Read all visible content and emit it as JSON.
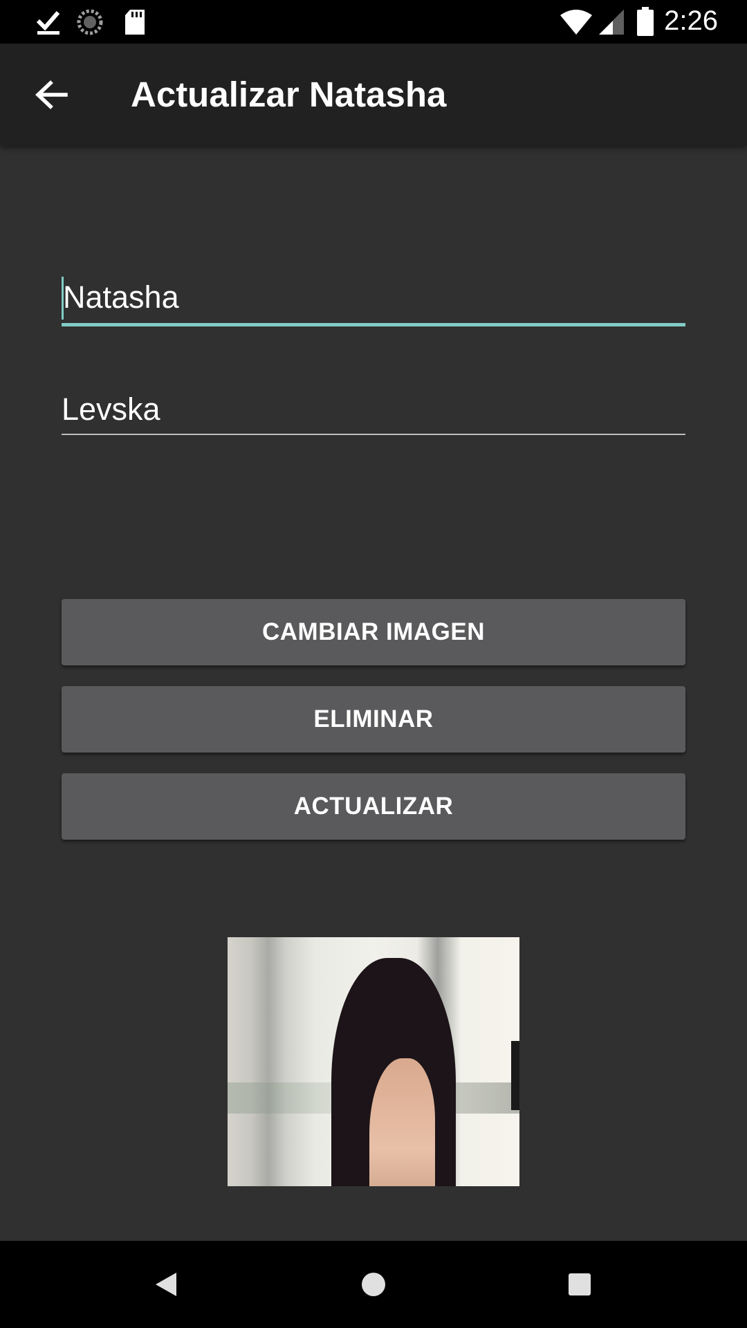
{
  "status_bar": {
    "time": "2:26",
    "icons": [
      "download-done-icon",
      "sync-icon",
      "sd-card-icon",
      "wifi-icon",
      "signal-icon",
      "battery-icon"
    ]
  },
  "app_bar": {
    "back_icon": "arrow-back-icon",
    "title": "Actualizar Natasha"
  },
  "form": {
    "first_name": {
      "value": "Natasha",
      "focused": true
    },
    "last_name": {
      "value": "Levska",
      "focused": false
    }
  },
  "buttons": {
    "change_image": "CAMBIAR IMAGEN",
    "delete": "ELIMINAR",
    "update": "ACTUALIZAR"
  },
  "photo": {
    "subject": "portrait-photo"
  },
  "nav_bar": {
    "back": "nav-back-icon",
    "home": "nav-home-icon",
    "recents": "nav-recents-icon"
  },
  "colors": {
    "accent": "#80cbc4",
    "background": "#303030",
    "app_bar": "#212121",
    "button": "#5a5a5c"
  }
}
